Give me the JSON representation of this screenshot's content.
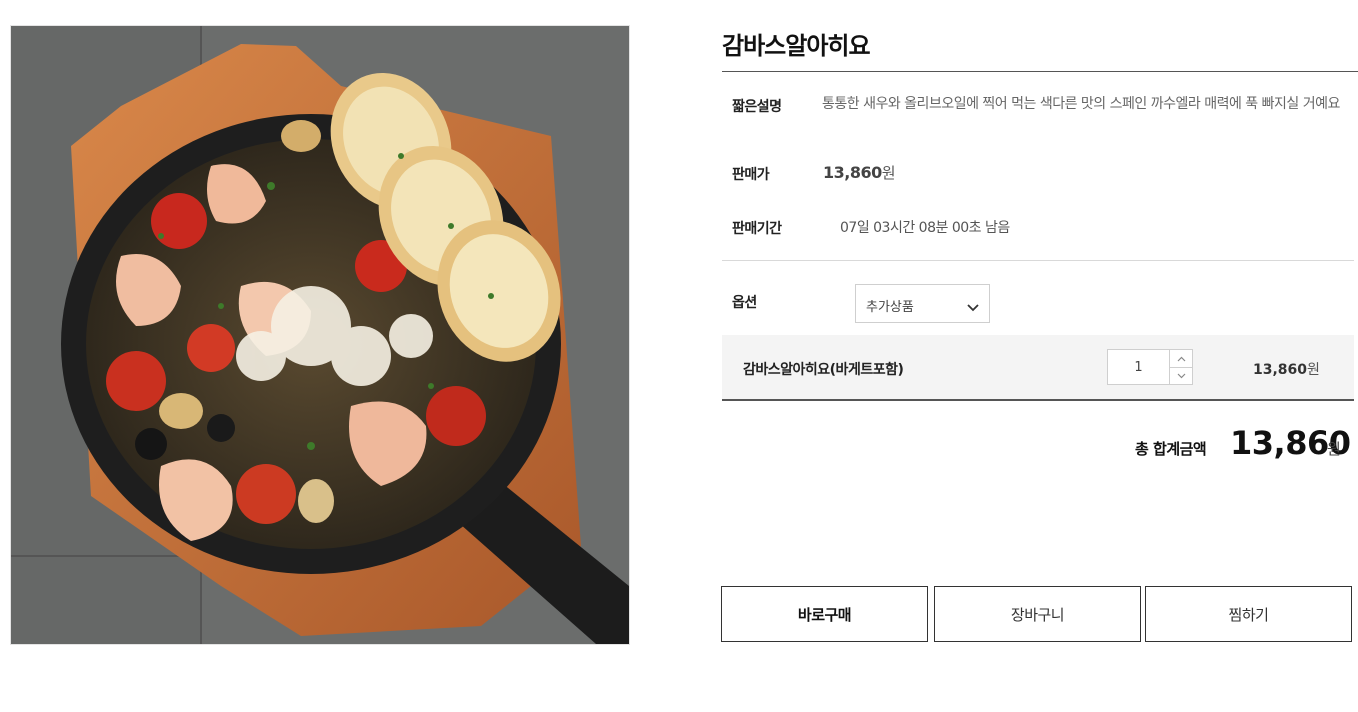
{
  "product": {
    "title": "감바스알아히요",
    "image_alt": "감바스알아히요"
  },
  "info": {
    "description_label": "짧은설명",
    "description": "통통한 새우와 올리브오일에 찍어 먹는 색다른 맛의 스페인 까수엘라 매력에 푹 빠지실 거예요",
    "price_label": "판매가",
    "price": "13,860",
    "price_unit": "원",
    "period_label": "판매기간",
    "period": "07일 03시간 08분 00초 남음"
  },
  "option": {
    "label": "옵션",
    "selected": "추가상품"
  },
  "cart_item": {
    "name": "감바스알아히요(바게트포함)",
    "quantity": "1",
    "price": "13,860",
    "price_unit": "원"
  },
  "total": {
    "label": "총 합계금액",
    "value": "13,860",
    "unit": "원"
  },
  "buttons": {
    "buy_now": "바로구매",
    "cart": "장바구니",
    "wishlist": "찜하기"
  },
  "icons": {
    "select": "chevron-down-icon",
    "qty_up": "chevron-up-icon",
    "qty_down": "chevron-down-icon"
  }
}
